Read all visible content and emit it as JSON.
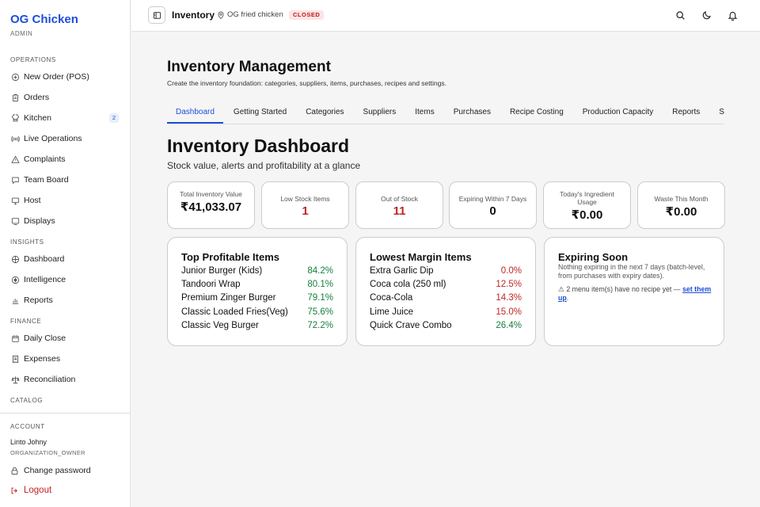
{
  "sidebar": {
    "brand": "OG Chicken",
    "role": "ADMIN",
    "sections": [
      {
        "label": "OPERATIONS",
        "items": [
          {
            "label": "New Order (POS)",
            "icon": "plus-circle-icon"
          },
          {
            "label": "Orders",
            "icon": "clipboard-icon"
          },
          {
            "label": "Kitchen",
            "icon": "chef-hat-icon",
            "badge": "2"
          },
          {
            "label": "Live Operations",
            "icon": "radio-icon"
          },
          {
            "label": "Complaints",
            "icon": "warning-triangle-icon"
          },
          {
            "label": "Team Board",
            "icon": "chat-icon"
          },
          {
            "label": "Host",
            "icon": "monitor-icon"
          },
          {
            "label": "Displays",
            "icon": "display-icon"
          }
        ]
      },
      {
        "label": "INSIGHTS",
        "items": [
          {
            "label": "Dashboard",
            "icon": "grid-icon"
          },
          {
            "label": "Intelligence",
            "icon": "brain-icon"
          },
          {
            "label": "Reports",
            "icon": "bar-chart-icon"
          }
        ]
      },
      {
        "label": "FINANCE",
        "items": [
          {
            "label": "Daily Close",
            "icon": "calendar-icon"
          },
          {
            "label": "Expenses",
            "icon": "receipt-icon"
          },
          {
            "label": "Reconciliation",
            "icon": "scale-icon"
          }
        ]
      },
      {
        "label": "CATALOG",
        "items": []
      }
    ],
    "account": {
      "label": "ACCOUNT",
      "name": "Linto Johny",
      "role": "ORGANIZATION_OWNER",
      "change_password": "Change password",
      "logout": "Logout"
    }
  },
  "topbar": {
    "title": "Inventory",
    "location": "OG fried chicken",
    "status": "CLOSED"
  },
  "page": {
    "title": "Inventory Management",
    "subtitle": "Create the inventory foundation: categories, suppliers, items, purchases, recipes and settings.",
    "tabs": [
      "Dashboard",
      "Getting Started",
      "Categories",
      "Suppliers",
      "Items",
      "Purchases",
      "Recipe Costing",
      "Production Capacity",
      "Reports",
      "Settings"
    ],
    "active_tab": 0
  },
  "dashboard": {
    "title": "Inventory Dashboard",
    "subtitle": "Stock value, alerts and profitability at a glance",
    "stats": [
      {
        "label": "Total Inventory Value",
        "value": "₹41,033.07",
        "color": "#111111"
      },
      {
        "label": "Low Stock Items",
        "value": "1",
        "color": "#c02626"
      },
      {
        "label": "Out of Stock",
        "value": "11",
        "color": "#c02626"
      },
      {
        "label": "Expiring Within 7 Days",
        "value": "0",
        "color": "#111111"
      },
      {
        "label": "Today's Ingredient Usage",
        "value": "₹0.00",
        "color": "#111111"
      },
      {
        "label": "Waste This Month",
        "value": "₹0.00",
        "color": "#111111"
      }
    ],
    "top_profitable": {
      "title": "Top Profitable Items",
      "rows": [
        {
          "name": "Junior Burger (Kids)",
          "value": "84.2%"
        },
        {
          "name": "Tandoori Wrap",
          "value": "80.1%"
        },
        {
          "name": "Premium Zinger Burger",
          "value": "79.1%"
        },
        {
          "name": "Classic Loaded Fries(Veg)",
          "value": "75.6%"
        },
        {
          "name": "Classic Veg Burger",
          "value": "72.2%"
        }
      ]
    },
    "lowest_margin": {
      "title": "Lowest Margin Items",
      "rows": [
        {
          "name": "Extra Garlic Dip",
          "value": "0.0%",
          "tone": "red"
        },
        {
          "name": "Coca cola (250 ml)",
          "value": "12.5%",
          "tone": "red"
        },
        {
          "name": "Coca-Cola",
          "value": "14.3%",
          "tone": "red"
        },
        {
          "name": "Lime Juice",
          "value": "15.0%",
          "tone": "red"
        },
        {
          "name": "Quick Crave Combo",
          "value": "26.4%",
          "tone": "green"
        }
      ]
    },
    "expiring_soon": {
      "title": "Expiring Soon",
      "text": "Nothing expiring in the next 7 days (batch-level, from purchases with expiry dates).",
      "warning": "⚠ 2 menu item(s) have no recipe yet — ",
      "link": "set them up",
      "warning_end": "."
    }
  },
  "colors": {
    "accent": "#1d4ed8",
    "danger": "#c02626",
    "success": "#15803d"
  }
}
